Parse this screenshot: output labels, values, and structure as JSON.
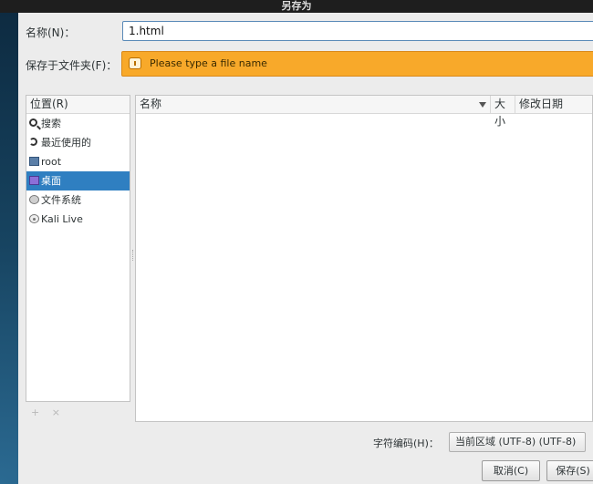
{
  "window": {
    "title": "另存为"
  },
  "form": {
    "name_label": "名称(N)：",
    "name_value": "1.html",
    "folder_label": "保存于文件夹(F)：",
    "warning_text": "Please type a file name"
  },
  "places": {
    "header": "位置(R)",
    "items": [
      {
        "label": "搜索",
        "icon": "search-icon"
      },
      {
        "label": "最近使用的",
        "icon": "recent-icon"
      },
      {
        "label": "root",
        "icon": "home-folder-icon"
      },
      {
        "label": "桌面",
        "icon": "desktop-folder-icon",
        "selected": true
      },
      {
        "label": "文件系统",
        "icon": "harddisk-icon"
      },
      {
        "label": "Kali Live",
        "icon": "optical-disc-icon"
      }
    ],
    "add_label": "+",
    "remove_label": "×"
  },
  "files": {
    "columns": {
      "name": "名称",
      "size": "大小",
      "modified": "修改日期"
    }
  },
  "footer": {
    "encoding_label": "字符编码(H)：",
    "encoding_value": "当前区域 (UTF-8) (UTF-8)",
    "cancel_label": "取消(C)",
    "save_label": "保存(S)"
  }
}
